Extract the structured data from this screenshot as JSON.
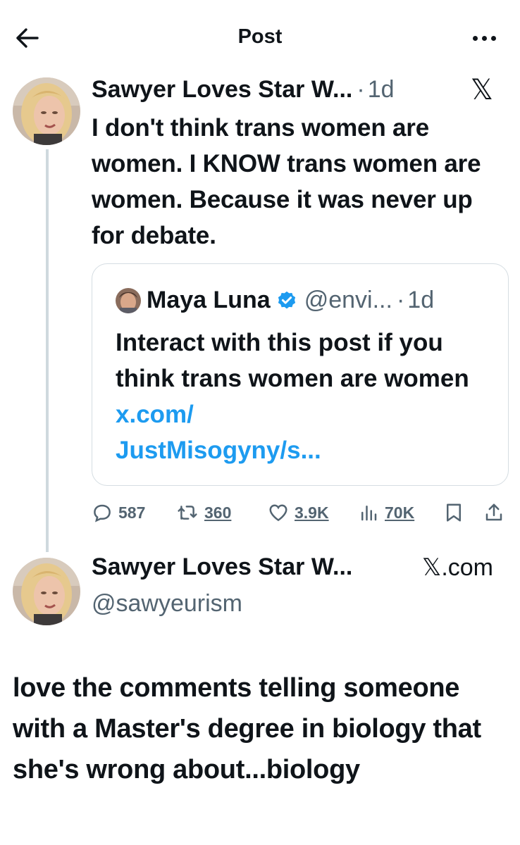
{
  "header": {
    "title": "Post",
    "back_icon": "arrow-left-icon",
    "more_icon": "more-dots-icon"
  },
  "post": {
    "author_name": "Sawyer Loves Star W...",
    "separator": "·",
    "time": "1d",
    "platform_icon": "x-logo-icon",
    "platform_logo_text": "𝕏",
    "text": "I don't think trans women are women. I KNOW trans women are women. Because it was never up for debate."
  },
  "quote": {
    "author_name": "Maya Luna",
    "verified_icon": "verified-badge-icon",
    "handle": "@envi...",
    "separator": "·",
    "time": "1d",
    "text": "Interact with this post if you think trans women are women",
    "link_line1": "x.com/",
    "link_line2": "JustMisogyny/s..."
  },
  "actions": {
    "replies": "587",
    "reposts": "360",
    "likes": "3.9K",
    "views": "70K"
  },
  "attribution": {
    "name": "Sawyer Loves Star W...",
    "handle": "@sawyeurism",
    "site": "𝕏.com"
  },
  "caption": "love the comments telling someone with a Master's degree in biology that she's wrong about...biology",
  "colors": {
    "link": "#1d9bf0",
    "secondary_text": "#536471",
    "border": "#d5dde2",
    "verified": "#1d9bf0"
  }
}
